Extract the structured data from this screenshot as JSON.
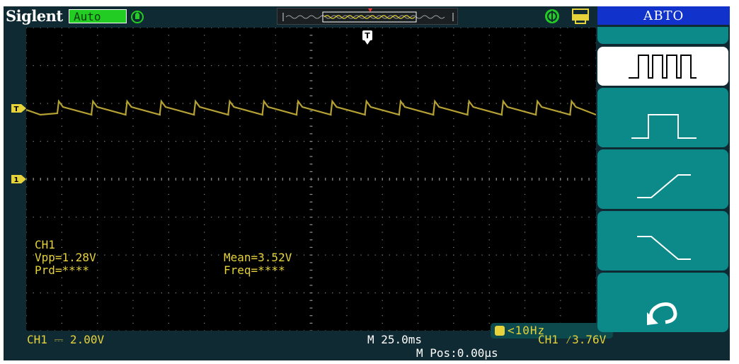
{
  "header": {
    "brand": "Siglent",
    "run_status": "Auto"
  },
  "side_menu": {
    "title": "АВТО",
    "items": [
      {
        "icon": "multi-period-waveform-icon",
        "selected": true
      },
      {
        "icon": "single-period-pulse-icon",
        "selected": false
      },
      {
        "icon": "rising-edge-icon",
        "selected": false
      },
      {
        "icon": "falling-edge-icon",
        "selected": false
      },
      {
        "icon": "undo-icon",
        "selected": false
      }
    ]
  },
  "measurements": {
    "channel": "CH1",
    "vpp": "Vpp=1.28V",
    "mean": "Mean=3.52V",
    "prd": "Prd=****",
    "freq": "Freq=****"
  },
  "trigger_frequency": "<10Hz",
  "markers": {
    "trigger_top": "T",
    "trigger_level": "T",
    "ch1_ground": "1"
  },
  "bottom_bar": {
    "ch1_scale": "CH1 ⎓ 2.00V",
    "timebase": "M 25.0ms",
    "trigger": "CH1 ⁄3.76V",
    "m_pos": "M Pos:0.00μs"
  },
  "colors": {
    "trace": "#b6a233",
    "readout": "#e6d23a",
    "menu_button": "#0c8a8a",
    "menu_title": "#1133cc",
    "run_badge": "#22cc22"
  }
}
